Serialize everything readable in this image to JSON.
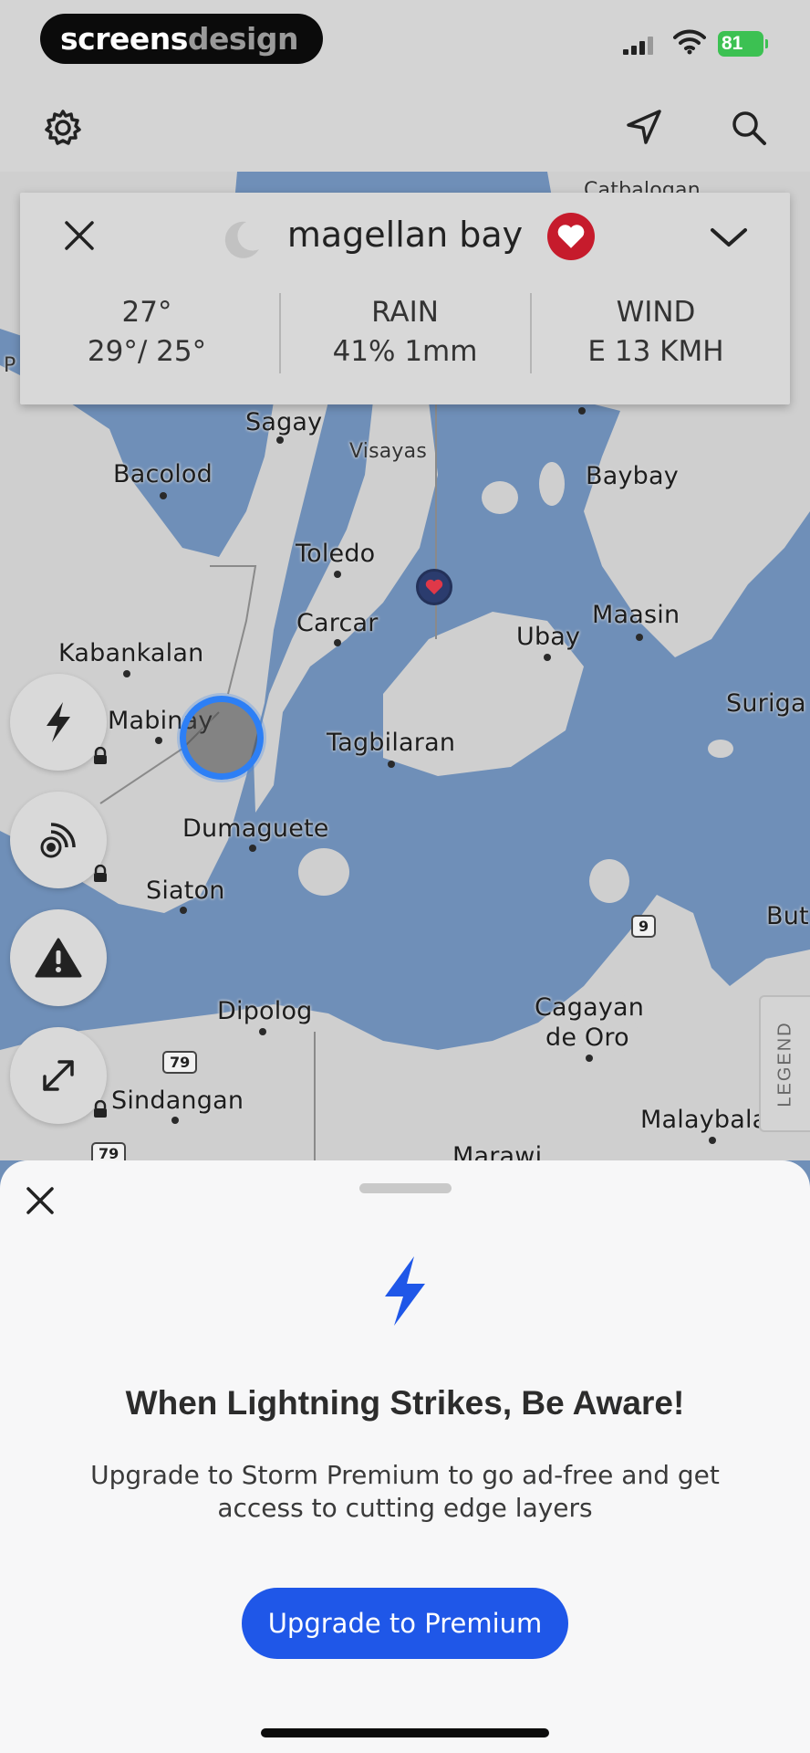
{
  "status_bar": {
    "brand_part1": "screens",
    "brand_part2": "design",
    "battery": "81"
  },
  "weather_card": {
    "location": "magellan bay",
    "temp_current": "27°",
    "temp_range": "29°/ 25°",
    "rain_label": "RAIN",
    "rain_value": "41% 1mm",
    "wind_label": "WIND",
    "wind_value": "E 13 KMH"
  },
  "map": {
    "labels": {
      "sagay": "Sagay",
      "visayas": "Visayas",
      "bacolod": "Bacolod",
      "baybay": "Baybay",
      "toledo": "Toledo",
      "carcar": "Carcar",
      "maasin": "Maasin",
      "ubay": "Ubay",
      "kabankalan": "Kabankalan",
      "mabinay": "Mabinay",
      "tagbilaran": "Tagbilaran",
      "surigao": "Suriga",
      "dumaguete": "Dumaguete",
      "siaton": "Siaton",
      "dipolog": "Dipolog",
      "cagayan1": "Cagayan",
      "cagayan2": "de Oro",
      "sindangan": "Sindangan",
      "malaybalay": "Malaybala",
      "marawi": "Marawi",
      "butuan": "But",
      "catbalogan": "Catbalogan",
      "pa": "P"
    },
    "road_shields": [
      "9",
      "79",
      "79"
    ]
  },
  "legend_label": "LEGEND",
  "sheet": {
    "title": "When Lightning Strikes, Be Aware!",
    "body": "Upgrade to Storm Premium to go ad-free and get access to cutting edge layers",
    "button": "Upgrade to Premium"
  },
  "colors": {
    "water": "#6f8fb8",
    "land": "#cfcfcf",
    "accent_blue": "#1f57e8",
    "heart_red": "#c61b2c",
    "battery_green": "#3cc152"
  },
  "icons": [
    "gear-icon",
    "navigation-arrow-icon",
    "search-icon",
    "close-icon",
    "moon-icon",
    "heart-icon",
    "chevron-down-icon",
    "lightning-icon",
    "radar-icon",
    "warning-icon",
    "expand-icon",
    "lock-icon"
  ]
}
